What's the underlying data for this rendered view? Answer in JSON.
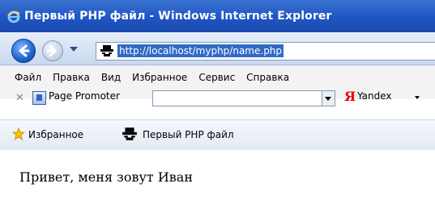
{
  "window": {
    "title": "Первый PHP файл - Windows Internet Explorer"
  },
  "navbar": {
    "url": "http://localhost/myphp/name.php"
  },
  "menu": {
    "items": [
      "Файл",
      "Правка",
      "Вид",
      "Избранное",
      "Сервис",
      "Справка"
    ]
  },
  "toolbar": {
    "page_promoter": "Page Promoter",
    "yandex_logo": "Я",
    "yandex": "Yandex"
  },
  "favorites": {
    "label": "Избранное",
    "tab_title": "Первый PHP файл"
  },
  "page": {
    "text": "Привет, меня зовут Иван"
  },
  "icons": [
    "ie-logo-icon",
    "back-arrow-icon",
    "forward-arrow-icon",
    "dropdown-icon",
    "page-favicon-icon",
    "close-x-icon",
    "page-promoter-icon",
    "star-icon"
  ],
  "colors": {
    "titlebar": "#1f55c4",
    "url_highlight": "#316ac5",
    "yandex_red": "#e00000"
  }
}
